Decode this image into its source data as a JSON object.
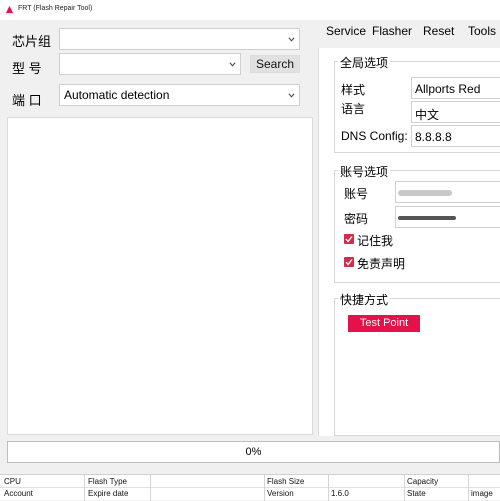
{
  "window": {
    "title": "FRT (Flash Repair Tool)"
  },
  "colors": {
    "accent": "#e5114a",
    "checkbox": "#d22c48"
  },
  "left": {
    "chipset_label": "芯片组",
    "model_label": "型  号",
    "port_label": "端  口",
    "chipset_value": "",
    "model_value": "",
    "port_value": "Automatic detection",
    "search_label": "Search"
  },
  "menu": [
    "Service",
    "Flasher",
    "Reset",
    "Tools"
  ],
  "global": {
    "title": "全局选项",
    "style_label": "样式",
    "style_value": "Allports Red",
    "language_label": "语言",
    "language_value": "中文",
    "dns_label": "DNS Config:",
    "dns_value": "8.8.8.8"
  },
  "account": {
    "title": "账号选项",
    "user_label": "账号",
    "password_label": "密码",
    "remember_label": "记住我",
    "remember_checked": true,
    "disclaimer_label": "免责声明",
    "disclaimer_checked": true
  },
  "shortcuts": {
    "title": "快捷方式",
    "test_point_label": "Test Point"
  },
  "progress": {
    "text": "0%",
    "value": 0
  },
  "status": {
    "row1": [
      "CPU",
      "Flash Type",
      "Flash Size",
      "Capacity"
    ],
    "row2": [
      "Account",
      "Expire date",
      "Version",
      "1.6.0",
      "State",
      "image"
    ]
  }
}
